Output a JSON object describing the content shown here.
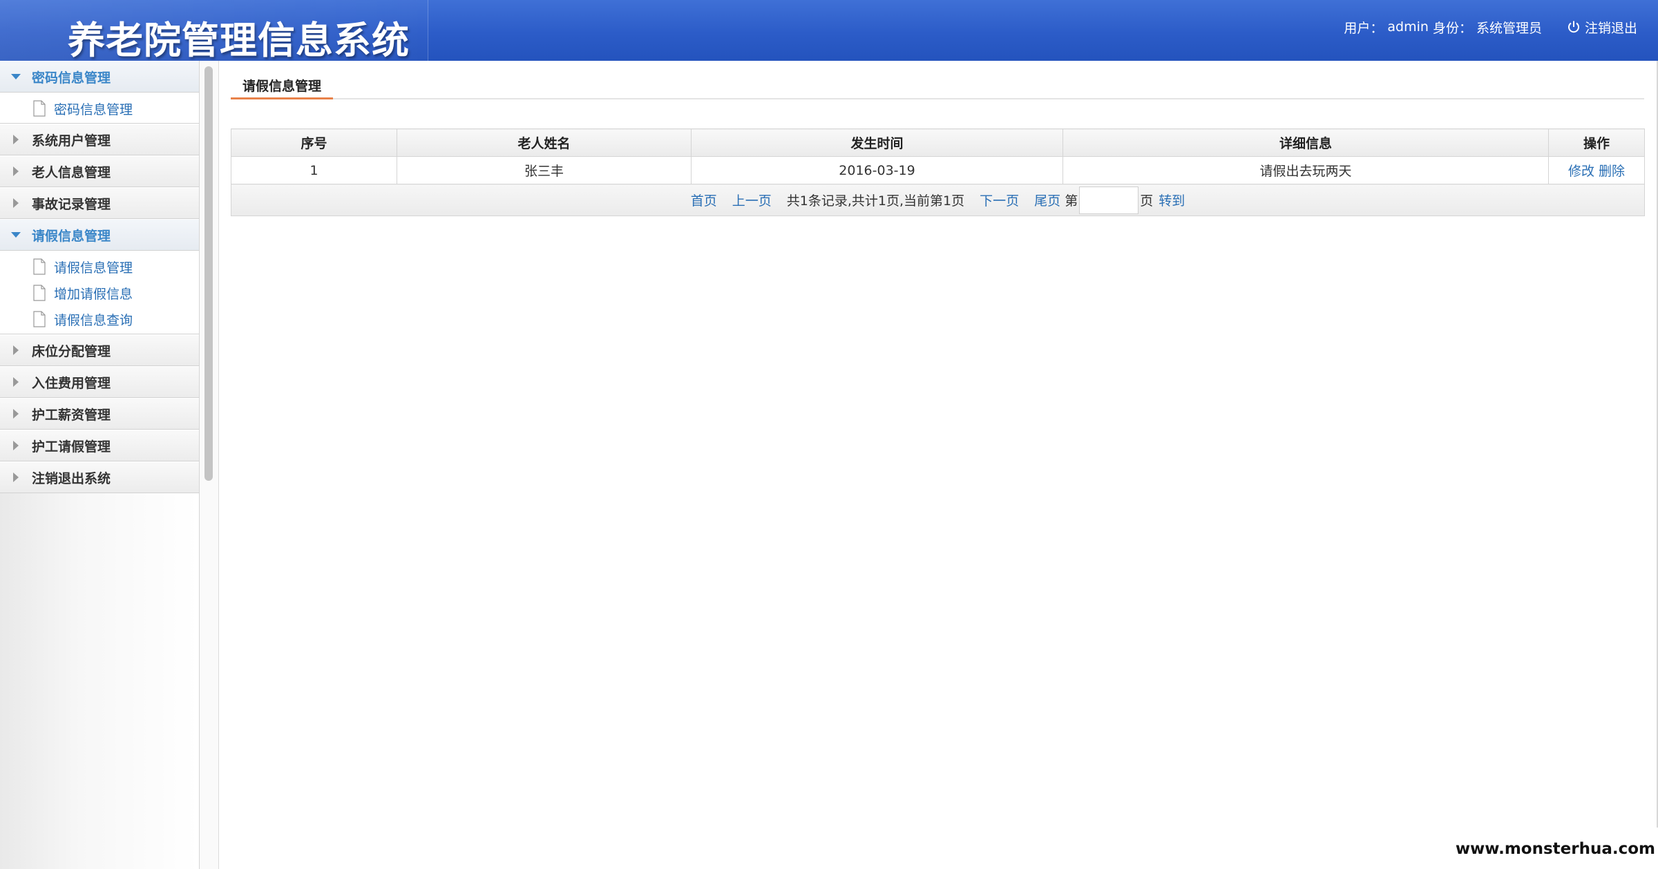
{
  "header": {
    "title": "养老院管理信息系统",
    "user_label": "用户：",
    "username": "admin",
    "role_label": "身份：",
    "role": "系统管理员",
    "logout_label": "注销退出",
    "logout_icon": "power-icon"
  },
  "sidebar": {
    "groups": [
      {
        "label": "密码信息管理",
        "open": true,
        "items": [
          {
            "label": "密码信息管理"
          }
        ]
      },
      {
        "label": "系统用户管理",
        "open": false
      },
      {
        "label": "老人信息管理",
        "open": false
      },
      {
        "label": "事故记录管理",
        "open": false
      },
      {
        "label": "请假信息管理",
        "open": true,
        "items": [
          {
            "label": "请假信息管理"
          },
          {
            "label": "增加请假信息"
          },
          {
            "label": "请假信息查询"
          }
        ]
      },
      {
        "label": "床位分配管理",
        "open": false
      },
      {
        "label": "入住费用管理",
        "open": false
      },
      {
        "label": "护工薪资管理",
        "open": false
      },
      {
        "label": "护工请假管理",
        "open": false
      },
      {
        "label": "注销退出系统",
        "open": false
      }
    ]
  },
  "main": {
    "tab_label": "请假信息管理",
    "table": {
      "columns": [
        "序号",
        "老人姓名",
        "发生时间",
        "详细信息",
        "操作"
      ],
      "rows": [
        {
          "index": "1",
          "name": "张三丰",
          "date": "2016-03-19",
          "detail": "请假出去玩两天",
          "edit": "修改",
          "delete": "删除"
        }
      ]
    },
    "pager": {
      "first": "首页",
      "prev": "上一页",
      "summary": "共1条记录,共计1页,当前第1页",
      "next": "下一页",
      "last": "尾页",
      "page_prefix": "第",
      "page_input_value": "",
      "page_suffix": "页",
      "goto": "转到"
    }
  },
  "watermark": "www.monsterhua.com",
  "colors": {
    "header_blue": "#2c5cc8",
    "link_blue": "#2a6fb5",
    "open_menu_blue": "#3a86c8",
    "tab_underline": "#e8824a"
  }
}
